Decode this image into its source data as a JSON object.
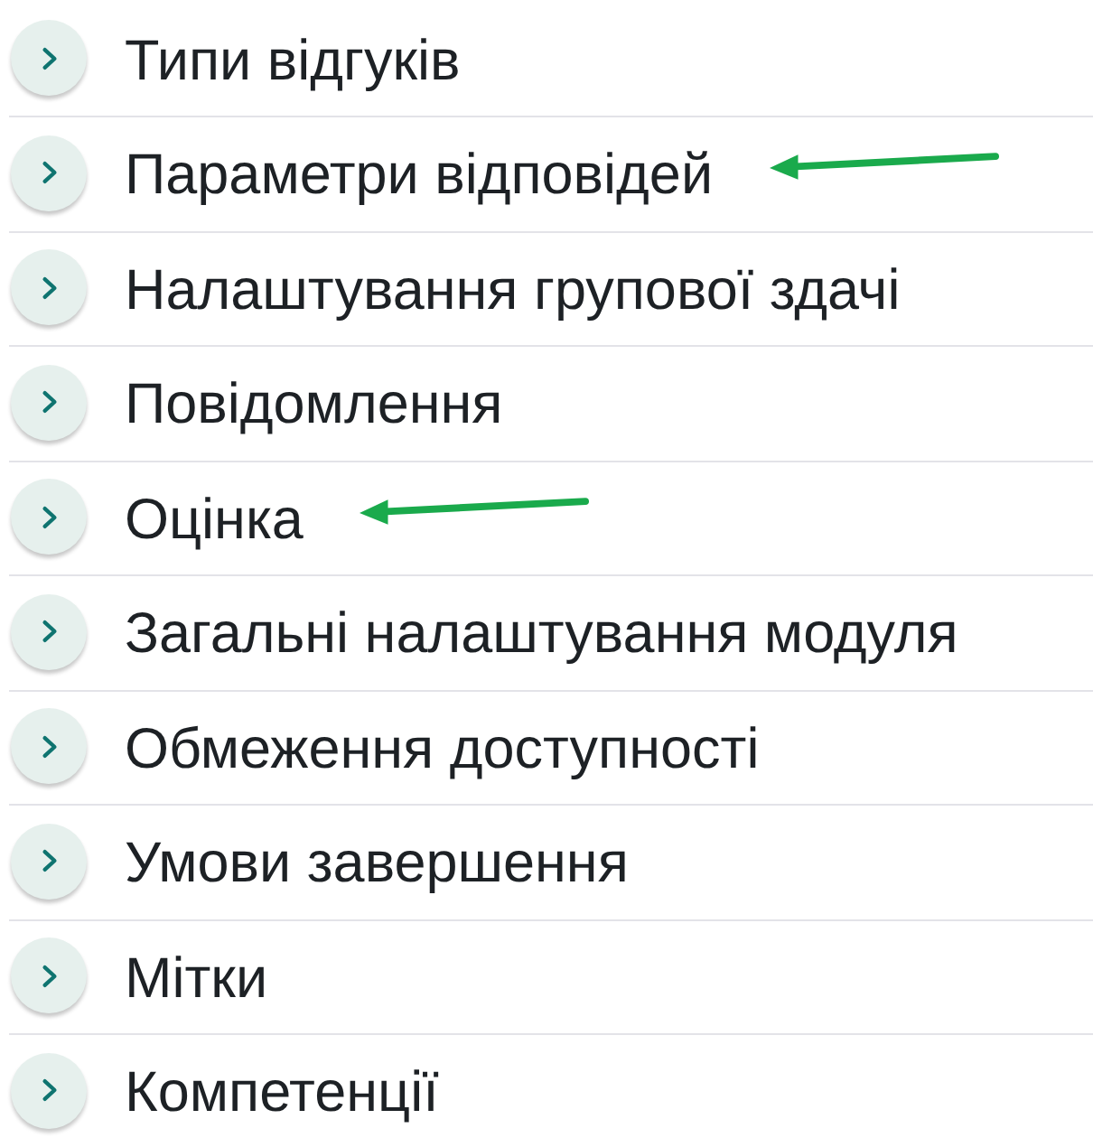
{
  "sections": [
    {
      "label": "Типи відгуків",
      "expanded": false,
      "arrow": false
    },
    {
      "label": "Параметри відповідей",
      "expanded": false,
      "arrow": true
    },
    {
      "label": "Налаштування групової здачі",
      "expanded": false,
      "arrow": false
    },
    {
      "label": "Повідомлення",
      "expanded": false,
      "arrow": false
    },
    {
      "label": "Оцінка",
      "expanded": false,
      "arrow": true
    },
    {
      "label": "Загальні налаштування модуля",
      "expanded": false,
      "arrow": false
    },
    {
      "label": "Обмеження доступності",
      "expanded": false,
      "arrow": false
    },
    {
      "label": "Умови завершення",
      "expanded": false,
      "arrow": false
    },
    {
      "label": "Мітки",
      "expanded": false,
      "arrow": false
    },
    {
      "label": "Компетенції",
      "expanded": false,
      "arrow": false
    }
  ]
}
